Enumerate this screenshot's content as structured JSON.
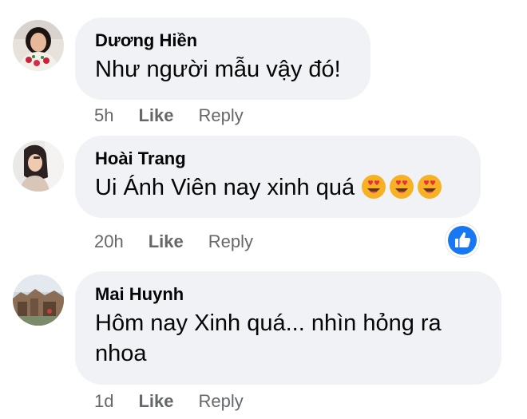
{
  "comments": [
    {
      "author": "Dương Hiền",
      "text": "Như người mẫu vậy đó!",
      "time": "5h",
      "like_label": "Like",
      "reply_label": "Reply",
      "avatar": "profile-photo"
    },
    {
      "author": "Hoài Trang",
      "text": "Ui Ánh Viên nay xinh quá",
      "emoji": [
        "heart-eyes-emoji",
        "heart-eyes-emoji",
        "heart-eyes-emoji"
      ],
      "time": "20h",
      "like_label": "Like",
      "reply_label": "Reply",
      "avatar": "profile-photo",
      "reaction": "like-reaction-icon",
      "reaction_color": "#1877f2"
    },
    {
      "author": "Mai Huynh",
      "text": "Hôm nay Xinh quá... nhìn hỏng ra nhoa",
      "time": "1d",
      "like_label": "Like",
      "reply_label": "Reply",
      "avatar": "profile-photo"
    }
  ],
  "colors": {
    "bubble": "#f0f2f5",
    "secondary_text": "#65676b",
    "primary_text": "#050505",
    "like_blue": "#1877f2",
    "emoji_face": "#f7b125",
    "emoji_heart": "#e8303c"
  }
}
